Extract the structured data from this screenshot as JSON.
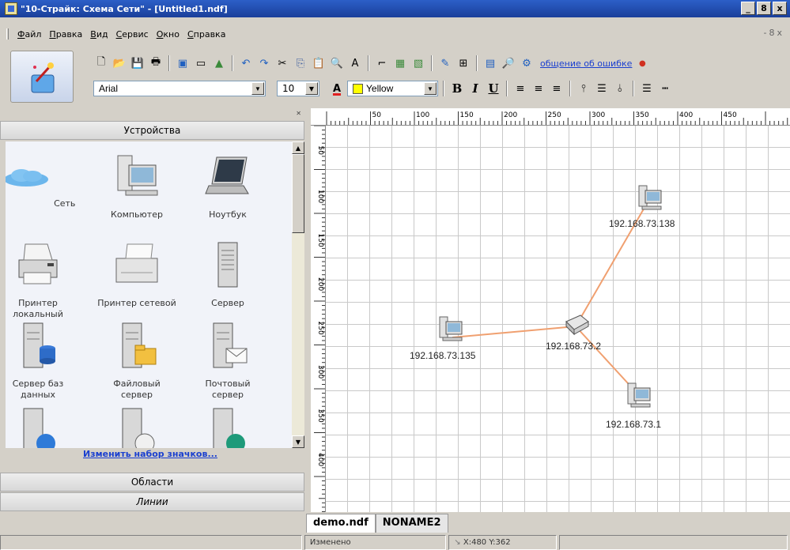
{
  "window": {
    "title": "\"10-Страйк: Схема Сети\" - [Untitled1.ndf]",
    "controls": [
      "_",
      "8",
      "x"
    ]
  },
  "menu": {
    "items": [
      "Файл",
      "Правка",
      "Вид",
      "Сервис",
      "Окно",
      "Справка"
    ],
    "mdi_controls": [
      "-",
      "8",
      "x"
    ]
  },
  "toolbar": {
    "report_label": "общение об ошибке",
    "font": "Arial",
    "font_size": "10",
    "color_label": "Yellow",
    "bold": "B",
    "italic": "I",
    "underline": "U",
    "color_letter": "A"
  },
  "left_panel": {
    "devices_header": "Устройства",
    "areas_header": "Области",
    "lines_header": "Линии",
    "change_icons_link": "Изменить набор значков...",
    "devices": [
      {
        "label": "Сеть",
        "icon": "cloud-icon"
      },
      {
        "label": "Компьютер",
        "icon": "computer-icon"
      },
      {
        "label": "Ноутбук",
        "icon": "laptop-icon"
      },
      {
        "label": "Принтер локальный",
        "icon": "local-printer-icon"
      },
      {
        "label": "Принтер сетевой",
        "icon": "network-printer-icon"
      },
      {
        "label": "Сервер",
        "icon": "server-icon"
      },
      {
        "label": "Сервер баз данных",
        "icon": "database-server-icon"
      },
      {
        "label": "Файловый сервер",
        "icon": "file-server-icon"
      },
      {
        "label": "Почтовый сервер",
        "icon": "mail-server-icon"
      }
    ]
  },
  "rulers": {
    "top_ticks": [
      "50",
      "100",
      "150",
      "200",
      "250",
      "300",
      "350",
      "400",
      "450"
    ],
    "left_ticks": [
      "50",
      "100",
      "150",
      "200",
      "250",
      "300",
      "350",
      "400"
    ]
  },
  "diagram": {
    "nodes": [
      {
        "id": "hub",
        "label": "192.168.73.2",
        "icon": "switch-icon"
      },
      {
        "id": "pc138",
        "label": "192.168.73.138",
        "icon": "computer-icon"
      },
      {
        "id": "pc135",
        "label": "192.168.73.135",
        "icon": "computer-icon"
      },
      {
        "id": "pc1",
        "label": "192.168.73.1",
        "icon": "computer-icon"
      }
    ],
    "link_color": "#f0a070"
  },
  "tabs": [
    "demo.ndf",
    "NONAME2"
  ],
  "status": {
    "state": "Изменено",
    "coords": "X:480  Y:362"
  }
}
